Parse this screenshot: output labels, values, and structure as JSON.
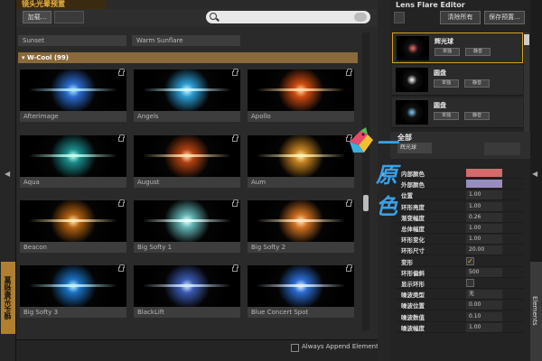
{
  "browser": {
    "title": "镜头光晕预置",
    "load_label": "加载...",
    "search_placeholder": "",
    "prev_row": [
      "Sunset",
      "Warm Sunflare"
    ],
    "category": "W-Cool (99)",
    "tiles": [
      "Afterimage",
      "Angels",
      "Apollo",
      "Aqua",
      "August",
      "Aum",
      "Beacon",
      "Big Softy 1",
      "Big Softy 2",
      "Big Softy 3",
      "BlackLift",
      "Blue Concert Spot"
    ],
    "vertical_tab": "镜头光晕预置",
    "append_label": "Always Append Elements"
  },
  "editor": {
    "title": "Lens Flare Editor",
    "clear_label": "清除所有",
    "save_label": "保存预置...",
    "elements": [
      {
        "name": "辉光球",
        "b1": "单独",
        "b2": "静音"
      },
      {
        "name": "圆盘",
        "b1": "单独",
        "b2": "静音"
      },
      {
        "name": "圆盘",
        "b1": "单独",
        "b2": "静音"
      }
    ],
    "props_title": "全部",
    "props_sub": "辉光球",
    "props": [
      {
        "label": "内部颜色",
        "kind": "swatch",
        "color": "#d46a6a"
      },
      {
        "label": "外部颜色",
        "kind": "swatch",
        "color": "#9a8cc0"
      },
      {
        "label": "位置",
        "kind": "value",
        "value": "1.00"
      },
      {
        "label": "环形亮度",
        "kind": "value",
        "value": "1.00"
      },
      {
        "label": "渐变幅度",
        "kind": "value",
        "value": "0.26"
      },
      {
        "label": "总体幅度",
        "kind": "value",
        "value": "1.00"
      },
      {
        "label": "环形变化",
        "kind": "value",
        "value": "1.00"
      },
      {
        "label": "环形尺寸",
        "kind": "value",
        "value": "20.00"
      },
      {
        "label": "变形",
        "kind": "check",
        "value": "✓"
      },
      {
        "label": "环形偏斜",
        "kind": "value",
        "value": "500"
      },
      {
        "label": "显示环形",
        "kind": "check",
        "value": ""
      },
      {
        "label": "噪波类型",
        "kind": "value",
        "value": "无"
      },
      {
        "label": "噪波位置",
        "kind": "value",
        "value": "0.00"
      },
      {
        "label": "噪波数值",
        "kind": "value",
        "value": "0.10"
      },
      {
        "label": "噪波幅度",
        "kind": "value",
        "value": "1.00"
      }
    ],
    "elements_tab": "Elements"
  },
  "watermark": "一原色"
}
